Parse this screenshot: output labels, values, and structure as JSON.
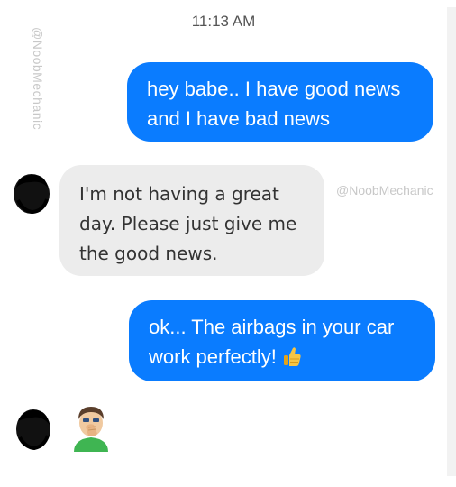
{
  "conversation": {
    "timestamp": "11:13 AM",
    "watermark": "@NoobMechanic",
    "messages": [
      {
        "sender": "me",
        "text": "hey babe.. I have good news and I have bad news"
      },
      {
        "sender": "them",
        "text": "I'm not having a great day. Please just give me the good news."
      },
      {
        "sender": "me",
        "text": "ok... The airbags in your car work perfectly!",
        "emoji": "thumbs-up-icon"
      },
      {
        "sender": "them",
        "emoji": "face-palm-icon"
      }
    ]
  },
  "colors": {
    "outgoing_bubble": "#0a7cff",
    "incoming_bubble": "#ececec"
  }
}
